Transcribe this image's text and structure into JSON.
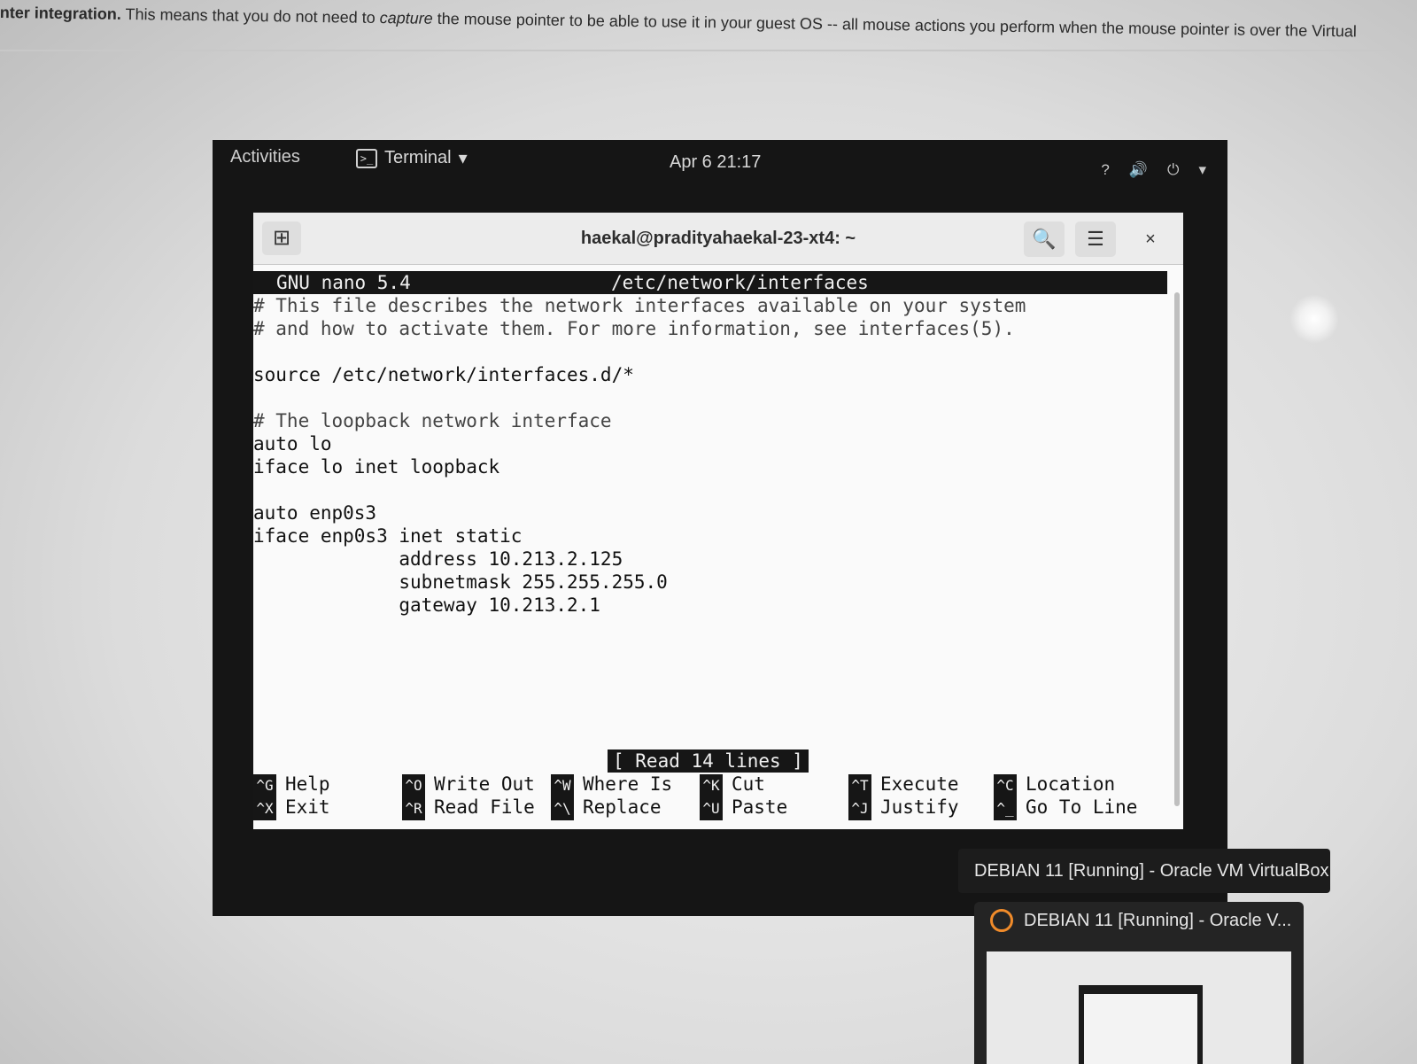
{
  "host": {
    "text_bold": "nter integration.",
    "text_a": " This means that you do not need to ",
    "text_italic": "capture",
    "text_b": " the mouse pointer to be able to use it in your guest OS -- all mouse actions you perform when the mouse pointer is over the Virtual"
  },
  "gnome": {
    "activities": "Activities",
    "app_name": "Terminal",
    "clock": "Apr 6  21:17",
    "tray": {
      "question": "?",
      "volume": "🔊",
      "power": "⏻",
      "arrow": "▾"
    }
  },
  "terminal": {
    "title": "haekal@pradityahaekal-23-xt4: ~",
    "newtab_glyph": "⊞",
    "search_glyph": "🔍",
    "menu_glyph": "☰",
    "close_glyph": "×"
  },
  "nano": {
    "version": "GNU nano 5.4",
    "filename": "/etc/network/interfaces",
    "lines": [
      "# This file describes the network interfaces available on your system",
      "# and how to activate them. For more information, see interfaces(5).",
      "",
      "source /etc/network/interfaces.d/*",
      "",
      "# The loopback network interface",
      "auto lo",
      "iface lo inet loopback",
      "",
      "auto enp0s3",
      "iface enp0s3 inet static",
      "             address 10.213.2.125",
      "             subnetmask 255.255.255.0",
      "             gateway 10.213.2.1"
    ],
    "status": "[ Read 14 lines ]",
    "shortcuts": [
      {
        "key": "^G",
        "label": "Help"
      },
      {
        "key": "^X",
        "label": "Exit"
      },
      {
        "key": "^O",
        "label": "Write Out"
      },
      {
        "key": "^R",
        "label": "Read File"
      },
      {
        "key": "^W",
        "label": "Where Is"
      },
      {
        "key": "^\\",
        "label": "Replace"
      },
      {
        "key": "^K",
        "label": "Cut"
      },
      {
        "key": "^U",
        "label": "Paste"
      },
      {
        "key": "^T",
        "label": "Execute"
      },
      {
        "key": "^J",
        "label": "Justify"
      },
      {
        "key": "^C",
        "label": "Location"
      },
      {
        "key": "^_",
        "label": "Go To Line"
      }
    ]
  },
  "virtualbox": {
    "window_title": "DEBIAN 11 [Running] - Oracle VM VirtualBox",
    "thumbnail_title": "DEBIAN 11 [Running] - Oracle V..."
  }
}
